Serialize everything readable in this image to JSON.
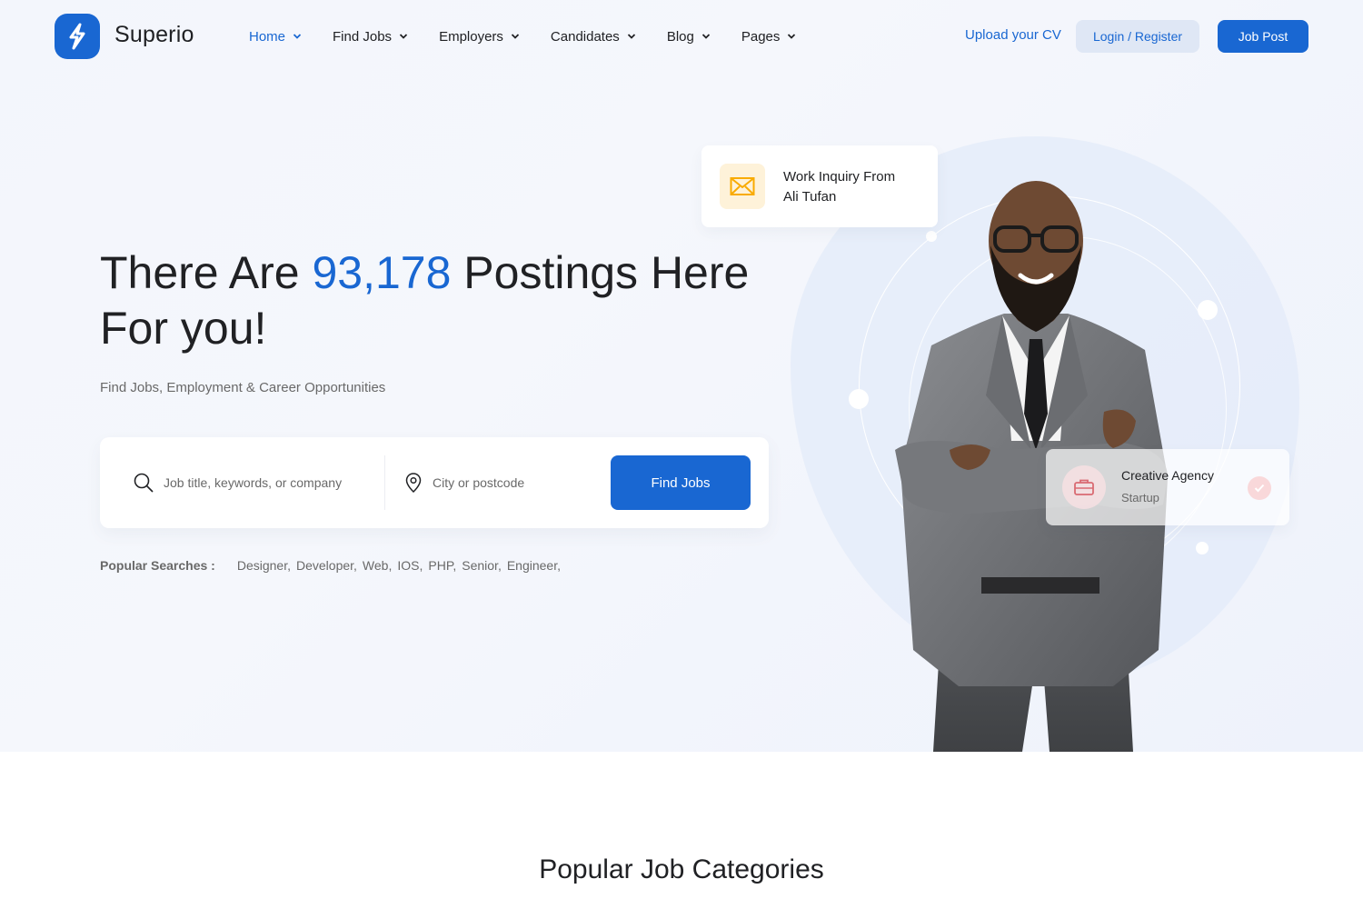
{
  "header": {
    "brand": "Superio",
    "nav": [
      {
        "label": "Home"
      },
      {
        "label": "Find Jobs"
      },
      {
        "label": "Employers"
      },
      {
        "label": "Candidates"
      },
      {
        "label": "Blog"
      },
      {
        "label": "Pages"
      }
    ],
    "upload_cv": "Upload your CV",
    "login_register": "Login / Register",
    "job_post": "Job Post"
  },
  "hero": {
    "headline_prefix": "There Are ",
    "headline_count": "93,178",
    "headline_suffix": " Postings Here For you!",
    "subhead": "Find Jobs, Employment & Career Opportunities",
    "search": {
      "keyword_placeholder": "Job title, keywords, or company",
      "location_placeholder": "City or postcode",
      "button_label": "Find Jobs"
    },
    "popular_label": "Popular Searches :",
    "popular_tags": [
      "Designer,",
      "Developer,",
      "Web,",
      "IOS,",
      "PHP,",
      "Senior,",
      "Engineer,"
    ]
  },
  "cards": {
    "inquiry": {
      "line1": "Work Inquiry From",
      "line2": "Ali Tufan",
      "icon": "envelope-icon"
    },
    "agency": {
      "title": "Creative Agency",
      "subtitle": "Startup",
      "icon": "briefcase-icon"
    }
  },
  "section": {
    "title": "Popular Job Categories"
  },
  "colors": {
    "accent": "#1967d2",
    "text": "#202124",
    "muted": "#696969",
    "hero_bg": "#f3f6fc"
  }
}
